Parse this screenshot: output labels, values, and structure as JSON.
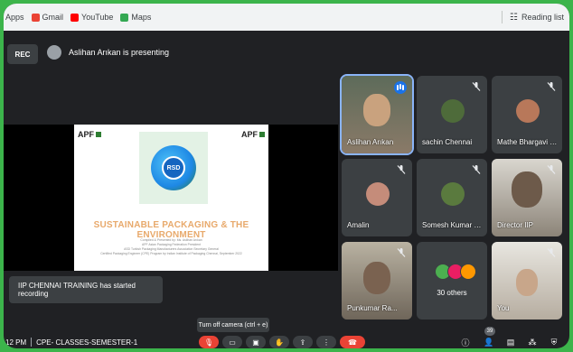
{
  "bookmarks": {
    "items": [
      {
        "label": "Apps",
        "color": "#5f6368"
      },
      {
        "label": "Gmail",
        "color": "#ea4335"
      },
      {
        "label": "YouTube",
        "color": "#ff0000"
      },
      {
        "label": "Maps",
        "color": "#34a853"
      }
    ],
    "reading_list": "Reading list"
  },
  "recording": {
    "rec_label": "REC",
    "presenter_text": "Aslihan Arıkan is presenting"
  },
  "slide": {
    "logo_left": "APF",
    "logo_right": "APF",
    "center_badge": "RSD",
    "title": "SUSTAINABLE PACKAGING & THE ENVIRONMENT",
    "lines": [
      "Compiled & Presented by: Ms. Aslihan Arıkan",
      "APF Asian Packaging Federation President",
      "ASD Turkish Packaging Manufacturers Association Secretary General",
      "Certified Packaging Engineer (CPE) Program by Indian Institute of Packaging Chennai, September 2022"
    ]
  },
  "toast": "IIP CHENNAI TRAINING has started recording",
  "participants": [
    {
      "name": "Aslihan Arıkan",
      "speaking": true,
      "color": "#c9a27e"
    },
    {
      "name": "sachin Chennai",
      "muted": true,
      "color": "#4e6b3a"
    },
    {
      "name": "Mathe Bhargavi S...",
      "muted": true,
      "color": "#b8785a"
    },
    {
      "name": "Amalin",
      "muted": true,
      "color": "#c58c7a"
    },
    {
      "name": "Somesh Kumar G...",
      "muted": true,
      "color": "#5a7a3e"
    },
    {
      "name": "Director IIP",
      "muted": true,
      "color": "#6d5a4a"
    },
    {
      "name": "Punkumar Ra...",
      "muted": true,
      "color": "#7a6250"
    },
    {
      "name": "30 others",
      "color": "#3c4043"
    },
    {
      "name": "You",
      "muted": true,
      "color": "#c8a68a"
    }
  ],
  "others_faces": [
    "#4caf50",
    "#e91e63",
    "#ff9800"
  ],
  "tooltip": "Turn off camera (ctrl + e)",
  "bottom": {
    "time": "12 PM",
    "meeting": "CPE- CLASSES-SEMESTER-1",
    "participant_count": "39"
  }
}
